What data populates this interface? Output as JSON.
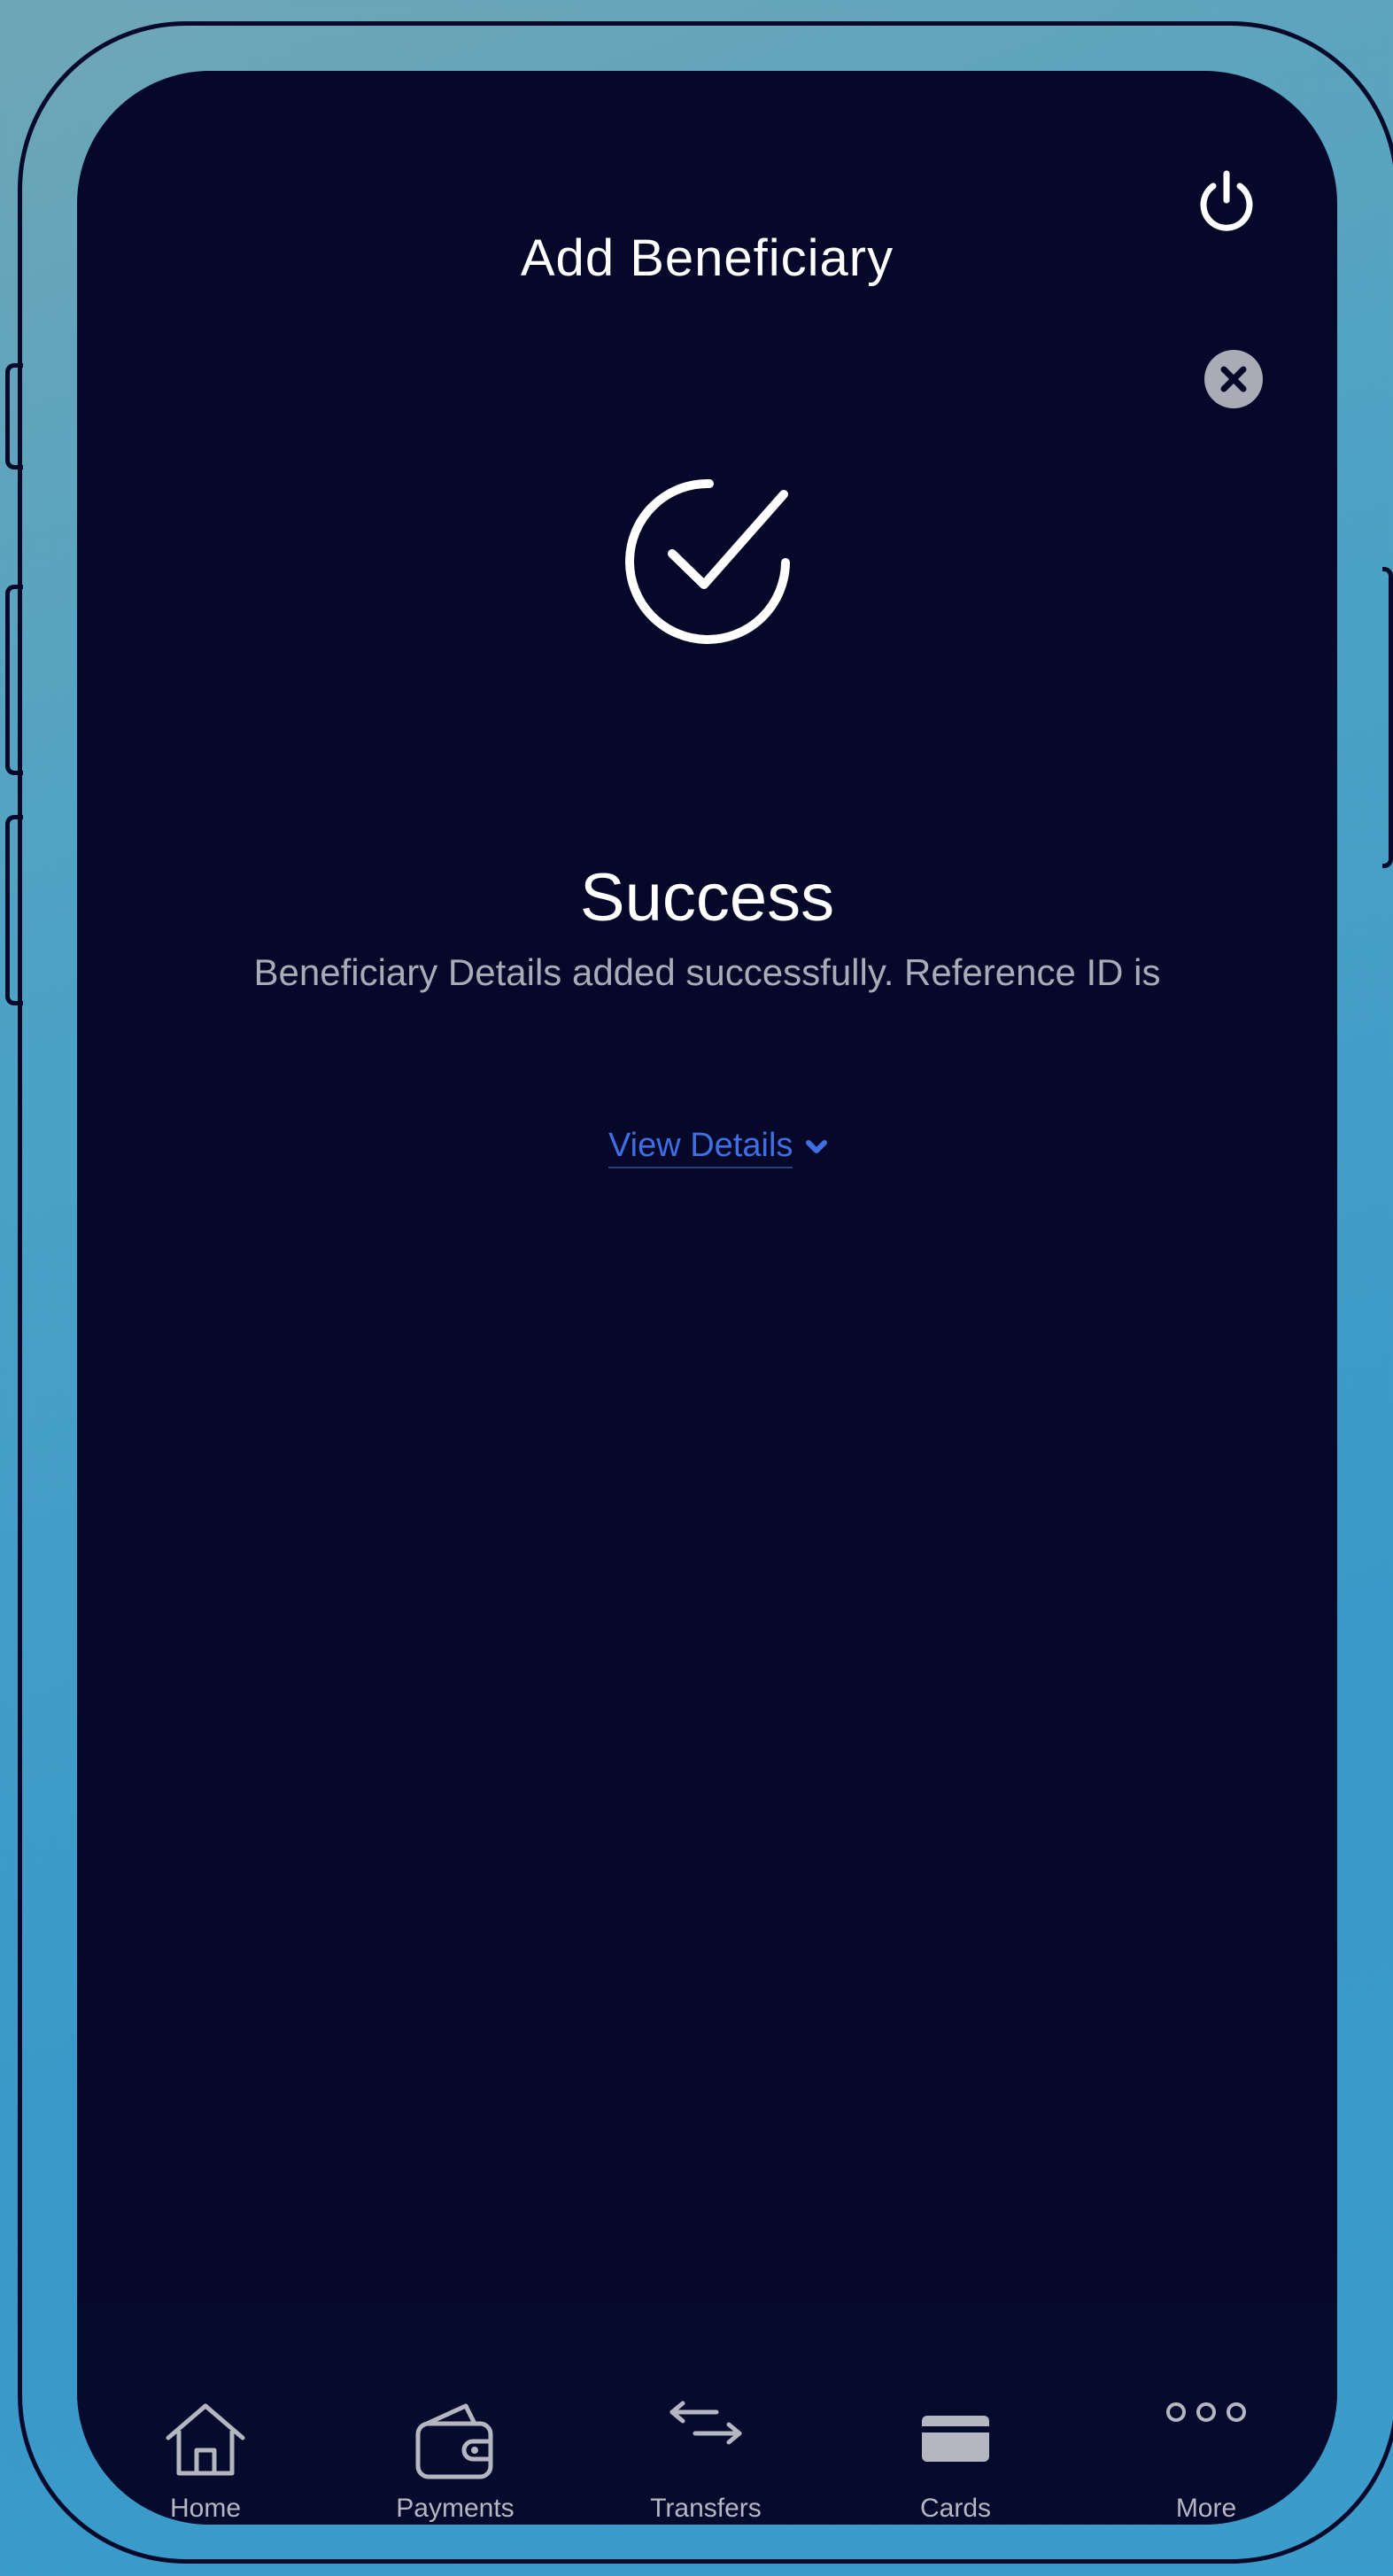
{
  "header": {
    "title": "Add Beneficiary"
  },
  "success": {
    "title": "Success",
    "message": "Beneficiary Details added successfully. Reference ID is",
    "view_details_label": "View Details"
  },
  "nav": {
    "items": [
      {
        "label": "Home",
        "icon": "home-icon"
      },
      {
        "label": "Payments",
        "icon": "wallet-icon"
      },
      {
        "label": "Transfers",
        "icon": "transfer-arrows-icon"
      },
      {
        "label": "Cards",
        "icon": "card-icon"
      },
      {
        "label": "More",
        "icon": "more-dots-icon"
      }
    ]
  },
  "colors": {
    "screen_bg": "#050829",
    "accent_link": "#3f6fe2",
    "muted_text": "#a9abb8"
  }
}
